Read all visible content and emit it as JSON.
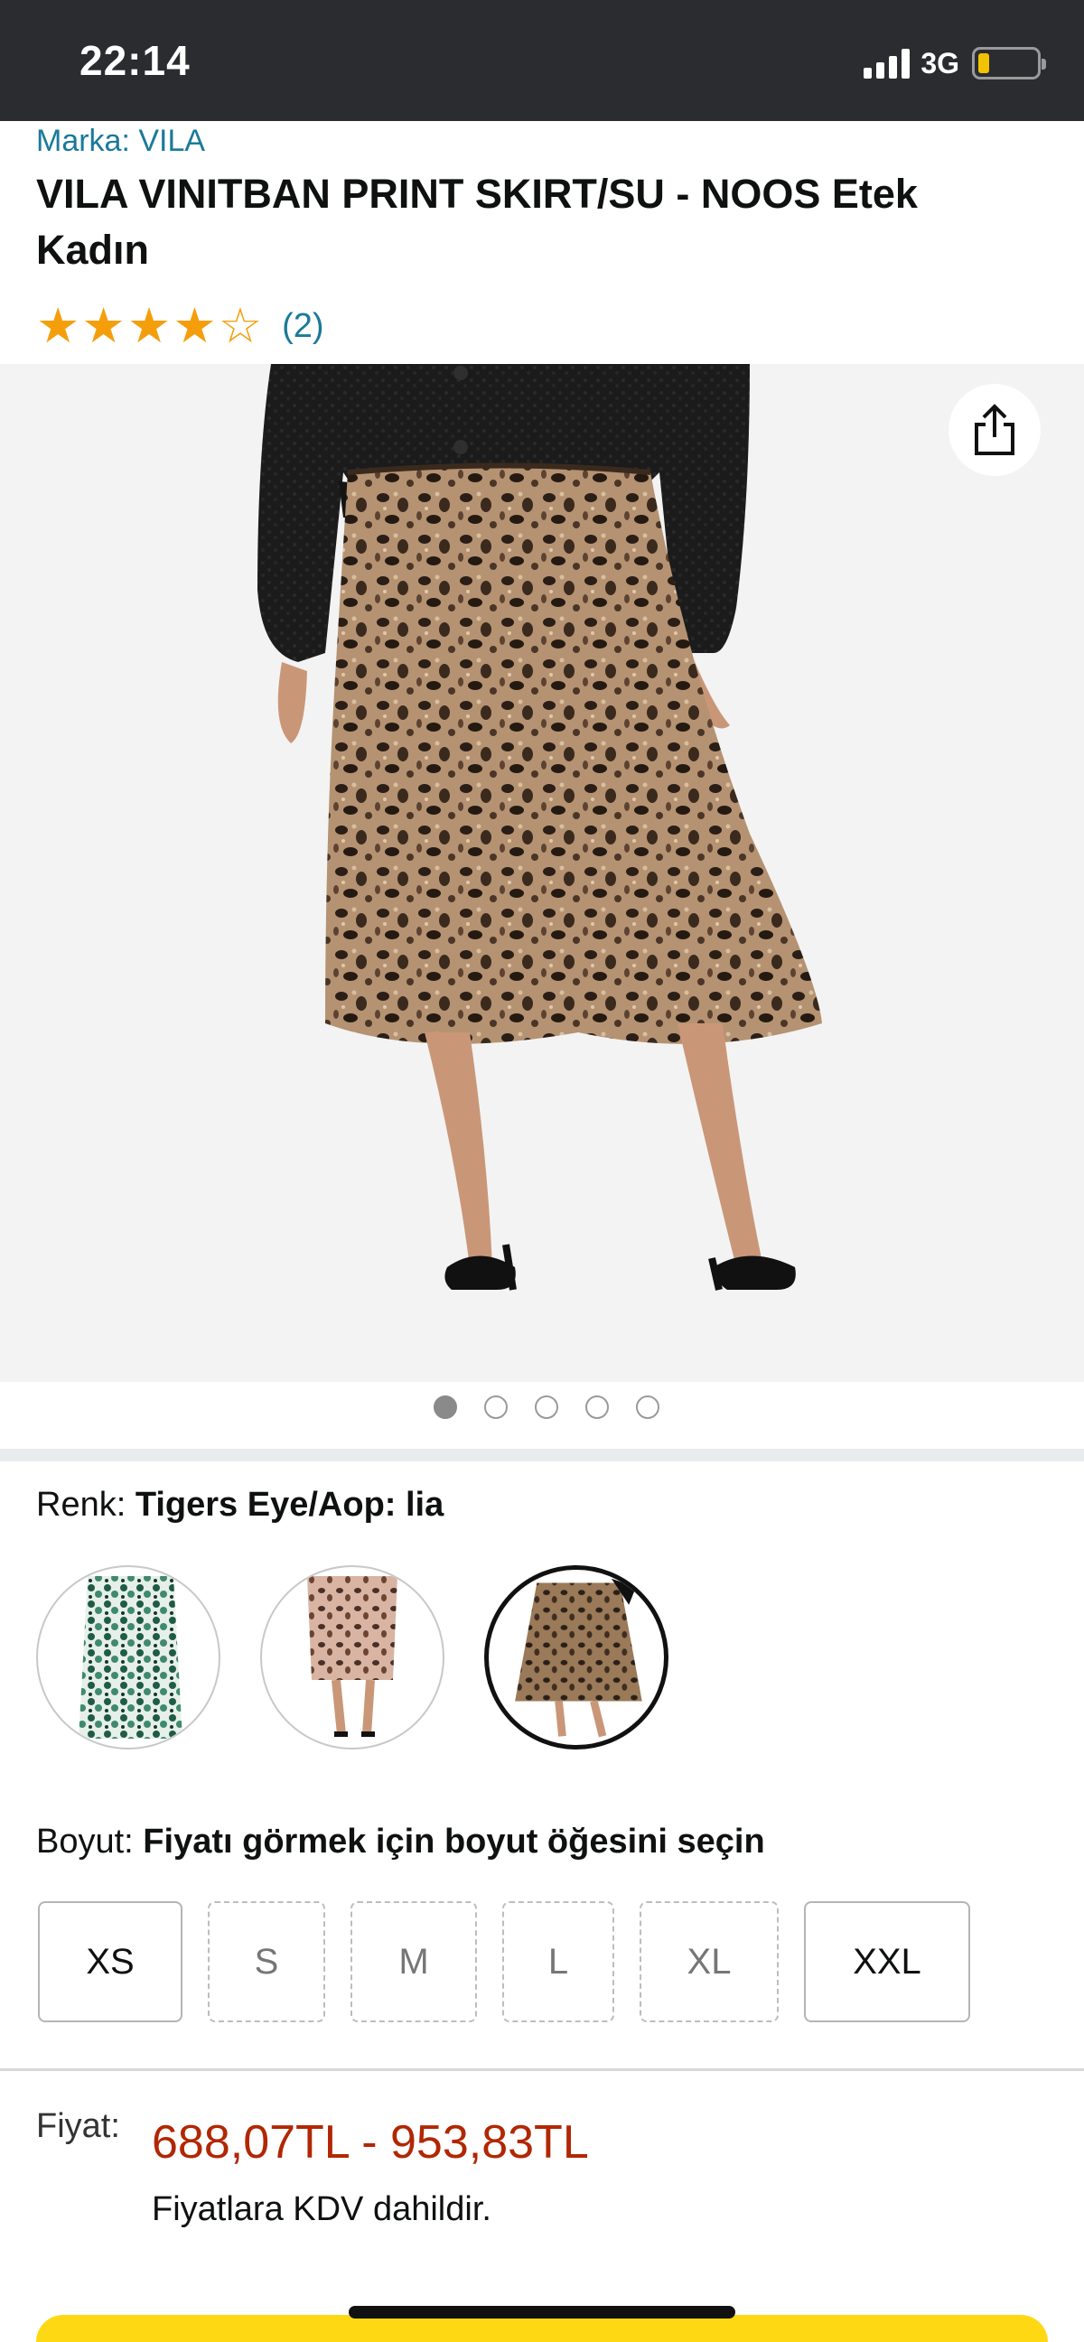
{
  "status_bar": {
    "time": "22:14",
    "network": "3G",
    "battery_level_percent": 20,
    "icons": [
      "signal-icon",
      "battery-icon"
    ]
  },
  "product": {
    "brand": "Marka: VILA",
    "title": "VILA VINITBAN PRINT SKIRT/SU - NOOS Etek Kadın",
    "rating_stars": 4,
    "rating_max": 5,
    "rating_count": "(2)"
  },
  "gallery": {
    "image_count": 5,
    "active_index": 0,
    "share_icon": "share-icon"
  },
  "color": {
    "label": "Renk:",
    "selected": "Tigers Eye/Aop: lia",
    "options": [
      {
        "name": "green-print-skirt",
        "colors": [
          "#2f6b54",
          "#ffffff"
        ]
      },
      {
        "name": "pink-leopard-skirt",
        "colors": [
          "#c9a08c",
          "#4a3026"
        ]
      },
      {
        "name": "tigers-eye-leopard-skirt",
        "colors": [
          "#8a6a48",
          "#2b2018"
        ]
      }
    ],
    "selected_index": 2
  },
  "size": {
    "label": "Boyut:",
    "prompt": "Fiyatı görmek için boyut öğesini seçin",
    "options": [
      {
        "label": "XS",
        "available": true
      },
      {
        "label": "S",
        "available": false
      },
      {
        "label": "M",
        "available": false
      },
      {
        "label": "L",
        "available": false
      },
      {
        "label": "XL",
        "available": false
      },
      {
        "label": "XXL",
        "available": true
      }
    ]
  },
  "price": {
    "label": "Fiyat:",
    "range": "688,07TL - 953,83TL",
    "vat_note": "Fiyatlara KDV dahildir."
  },
  "colors": {
    "accent_link": "#1a7a9a",
    "price_red": "#b12704",
    "star": "#f59e0b",
    "cta_yellow": "#ffd814",
    "status_bar_bg": "#2a2c30"
  }
}
